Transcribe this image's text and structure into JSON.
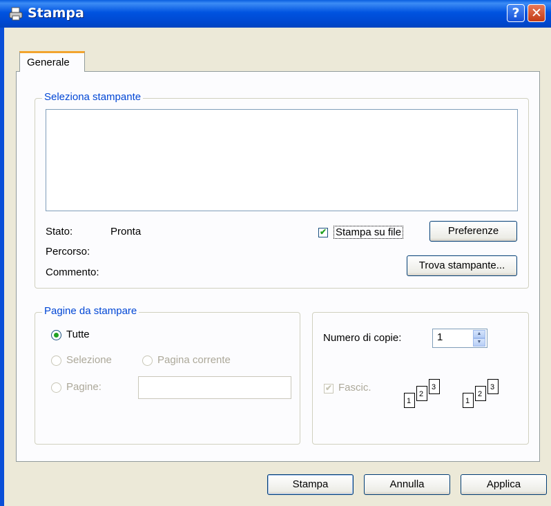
{
  "window": {
    "title": "Stampa",
    "help_glyph": "?",
    "close_glyph": "✕"
  },
  "tabs": [
    {
      "label": "Generale"
    }
  ],
  "select_printer": {
    "legend": "Seleziona stampante",
    "status_label": "Stato:",
    "status_value": "Pronta",
    "path_label": "Percorso:",
    "comment_label": "Commento:",
    "print_to_file": {
      "label": "Stampa su file",
      "checked": true
    },
    "preferences_button": "Preferenze",
    "find_printer_button": "Trova stampante..."
  },
  "page_range": {
    "legend": "Pagine da stampare",
    "all": {
      "label": "Tutte",
      "selected": true
    },
    "selection": {
      "label": "Selezione",
      "enabled": false
    },
    "current_page": {
      "label": "Pagina corrente",
      "enabled": false
    },
    "pages": {
      "label": "Pagine:",
      "enabled": false,
      "value": ""
    }
  },
  "copies": {
    "label": "Numero di copie:",
    "value": "1",
    "collate": {
      "label": "Fascic.",
      "checked": true,
      "enabled": false
    },
    "collate_pages": [
      "1",
      "2",
      "3"
    ]
  },
  "buttons": {
    "print": "Stampa",
    "cancel": "Annulla",
    "apply": "Applica"
  },
  "colors": {
    "titlebar": "#0053e0",
    "legend_text": "#0046d5",
    "face": "#ece9d8",
    "tab_accent": "#f2a42e"
  }
}
